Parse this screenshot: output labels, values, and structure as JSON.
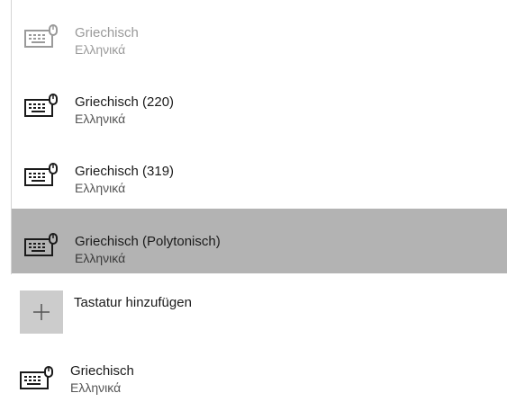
{
  "dropdown": {
    "options": [
      {
        "name": "Griechisch",
        "language": "Ελληνικά",
        "state": "dimmed",
        "icon": "keyboard-icon"
      },
      {
        "name": "Griechisch (220)",
        "language": "Ελληνικά",
        "state": "normal",
        "icon": "keyboard-icon"
      },
      {
        "name": "Griechisch (319)",
        "language": "Ελληνικά",
        "state": "normal",
        "icon": "keyboard-icon"
      },
      {
        "name": "Griechisch (Polytonisch)",
        "language": "Ελληνικά",
        "state": "selected",
        "icon": "keyboard-icon"
      }
    ]
  },
  "add_keyboard": {
    "label": "Tastatur hinzufügen",
    "icon": "plus-icon"
  },
  "installed_keyboard": {
    "name": "Griechisch",
    "language": "Ελληνικά",
    "icon": "keyboard-icon"
  },
  "colors": {
    "selected_background": "#b3b3b3",
    "plus_tile_background": "#cccccc",
    "dimmed_text": "#9a9a9a"
  }
}
